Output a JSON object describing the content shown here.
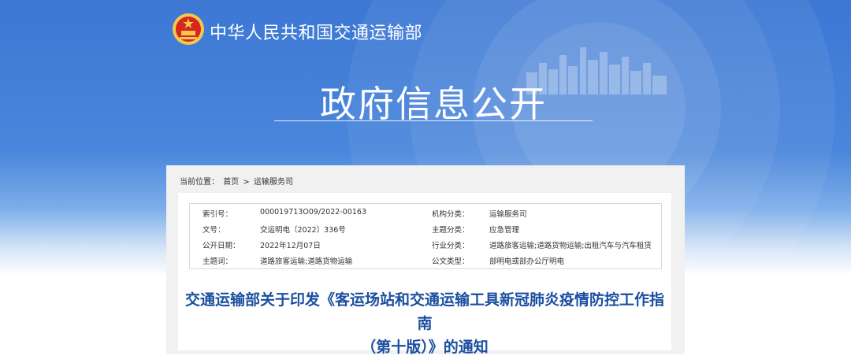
{
  "header": {
    "ministry_name": "中华人民共和国交通运输部",
    "section_title": "政府信息公开"
  },
  "breadcrumb": {
    "label": "当前位置：",
    "items": [
      "首页",
      "运输服务司"
    ],
    "separator": ">"
  },
  "metadata": [
    {
      "label": "索引号：",
      "value": "000019713O09/2022-00163",
      "label2": "机构分类：",
      "value2": "运输服务司"
    },
    {
      "label": "文号：",
      "value": "交运明电〔2022〕336号",
      "label2": "主题分类：",
      "value2": "应急管理"
    },
    {
      "label": "公开日期：",
      "value": "2022年12月07日",
      "label2": "行业分类：",
      "value2": "道路旅客运输;道路货物运输;出租汽车与汽车租赁"
    },
    {
      "label": "主题词：",
      "value": "道路旅客运输;道路货物运输",
      "label2": "公文类型：",
      "value2": "部明电或部办公厅明电"
    }
  ],
  "document": {
    "title_line1": "交通运输部关于印发《客运场站和交通运输工具新冠肺炎疫情防控工作指南",
    "title_line2": "（第十版）》的通知"
  },
  "colors": {
    "banner_blue": "#3c78d4",
    "title_blue": "#1b4fa0",
    "emblem_red": "#d7261e",
    "emblem_gold": "#f2c94c"
  }
}
